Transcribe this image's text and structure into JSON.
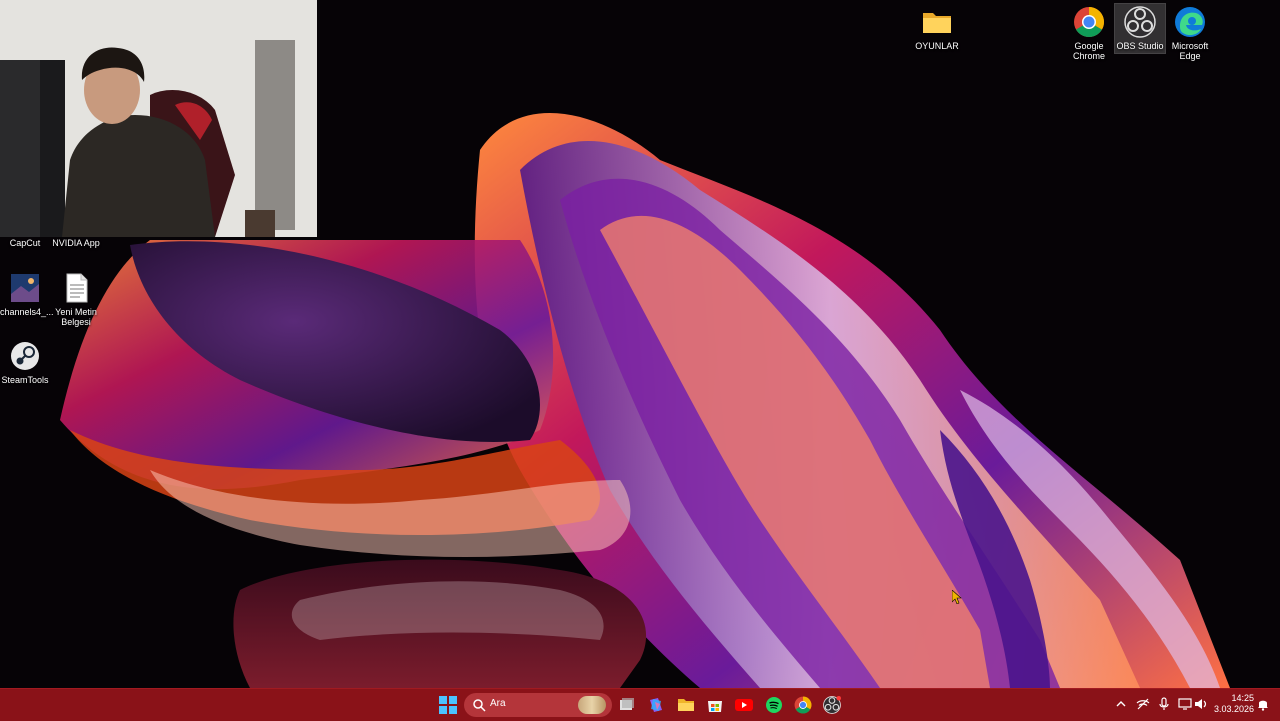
{
  "desktop": {
    "icons_left": [
      {
        "label": "CapCut",
        "icon": "capcut-icon"
      },
      {
        "label": "NVIDIA App",
        "icon": "nvidia-icon"
      },
      {
        "label": "channels4_...",
        "icon": "image-file-icon"
      },
      {
        "label": "Yeni Metin Belgesi",
        "icon": "text-file-icon"
      },
      {
        "label": "SteamTools",
        "icon": "steam-icon"
      }
    ],
    "icons_right": [
      {
        "label": "OYUNLAR",
        "icon": "folder-icon"
      },
      {
        "label": "Google Chrome",
        "icon": "chrome-icon"
      },
      {
        "label": "OBS Studio",
        "icon": "obs-icon",
        "selected": true
      },
      {
        "label": "Microsoft Edge",
        "icon": "edge-icon"
      }
    ]
  },
  "taskbar": {
    "search_placeholder": "Ara",
    "pinned_apps": [
      "start-icon",
      "task-view-icon",
      "copilot-icon",
      "file-explorer-icon",
      "store-icon",
      "youtube-icon",
      "spotify-icon",
      "chrome-icon",
      "obs-icon"
    ],
    "tray_icons": [
      "chevron-up-icon",
      "network-off-icon",
      "microphone-icon",
      "display-icon",
      "speaker-icon",
      "notification-icon"
    ],
    "time": "14:25",
    "date": "3.03.2026"
  },
  "colors": {
    "taskbar": "#8a1218",
    "search_box": "#b4353a"
  }
}
